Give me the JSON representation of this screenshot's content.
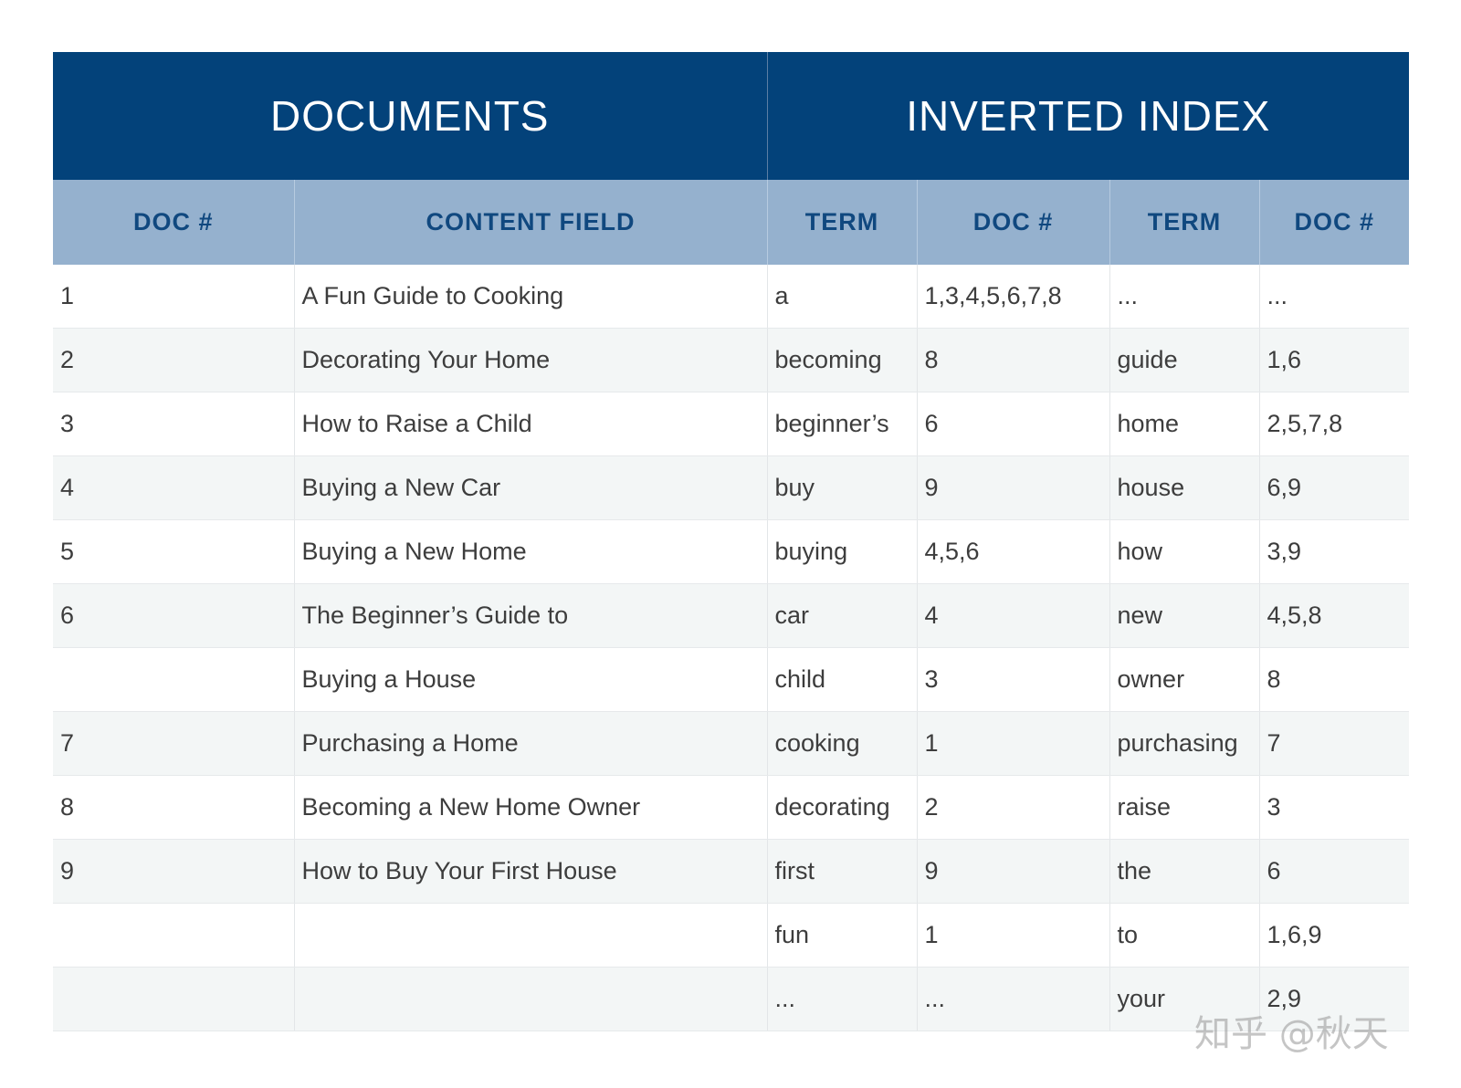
{
  "table": {
    "group_headers": [
      "DOCUMENTS",
      "INVERTED INDEX"
    ],
    "column_headers": [
      "DOC #",
      "CONTENT FIELD",
      "TERM",
      "DOC #",
      "TERM",
      "DOC #"
    ],
    "rows": [
      [
        "1",
        "A Fun Guide to Cooking",
        "a",
        "1,3,4,5,6,7,8",
        "...",
        "..."
      ],
      [
        "2",
        "Decorating Your Home",
        "becoming",
        "8",
        "guide",
        "1,6"
      ],
      [
        "3",
        "How to Raise a Child",
        "beginner’s",
        "6",
        "home",
        "2,5,7,8"
      ],
      [
        "4",
        "Buying a New Car",
        "buy",
        "9",
        "house",
        "6,9"
      ],
      [
        "5",
        "Buying a New Home",
        "buying",
        "4,5,6",
        "how",
        "3,9"
      ],
      [
        "6",
        "The Beginner’s Guide to",
        "car",
        "4",
        "new",
        "4,5,8"
      ],
      [
        "",
        "Buying a House",
        "child",
        "3",
        "owner",
        "8"
      ],
      [
        "7",
        "Purchasing a Home",
        "cooking",
        "1",
        "purchasing",
        "7"
      ],
      [
        "8",
        "Becoming a New Home Owner",
        "decorating",
        "2",
        "raise",
        "3"
      ],
      [
        "9",
        "How to Buy Your First House",
        "first",
        "9",
        "the",
        "6"
      ],
      [
        "",
        "",
        "fun",
        "1",
        "to",
        "1,6,9"
      ],
      [
        "",
        "",
        "...",
        "...",
        "your",
        "2,9"
      ]
    ]
  },
  "watermark": "知乎 @秋天",
  "colors": {
    "header_band": "#03427a",
    "subheader_band": "#95b1ce",
    "subheader_text": "#10487f",
    "alt_row": "#f3f6f6"
  }
}
